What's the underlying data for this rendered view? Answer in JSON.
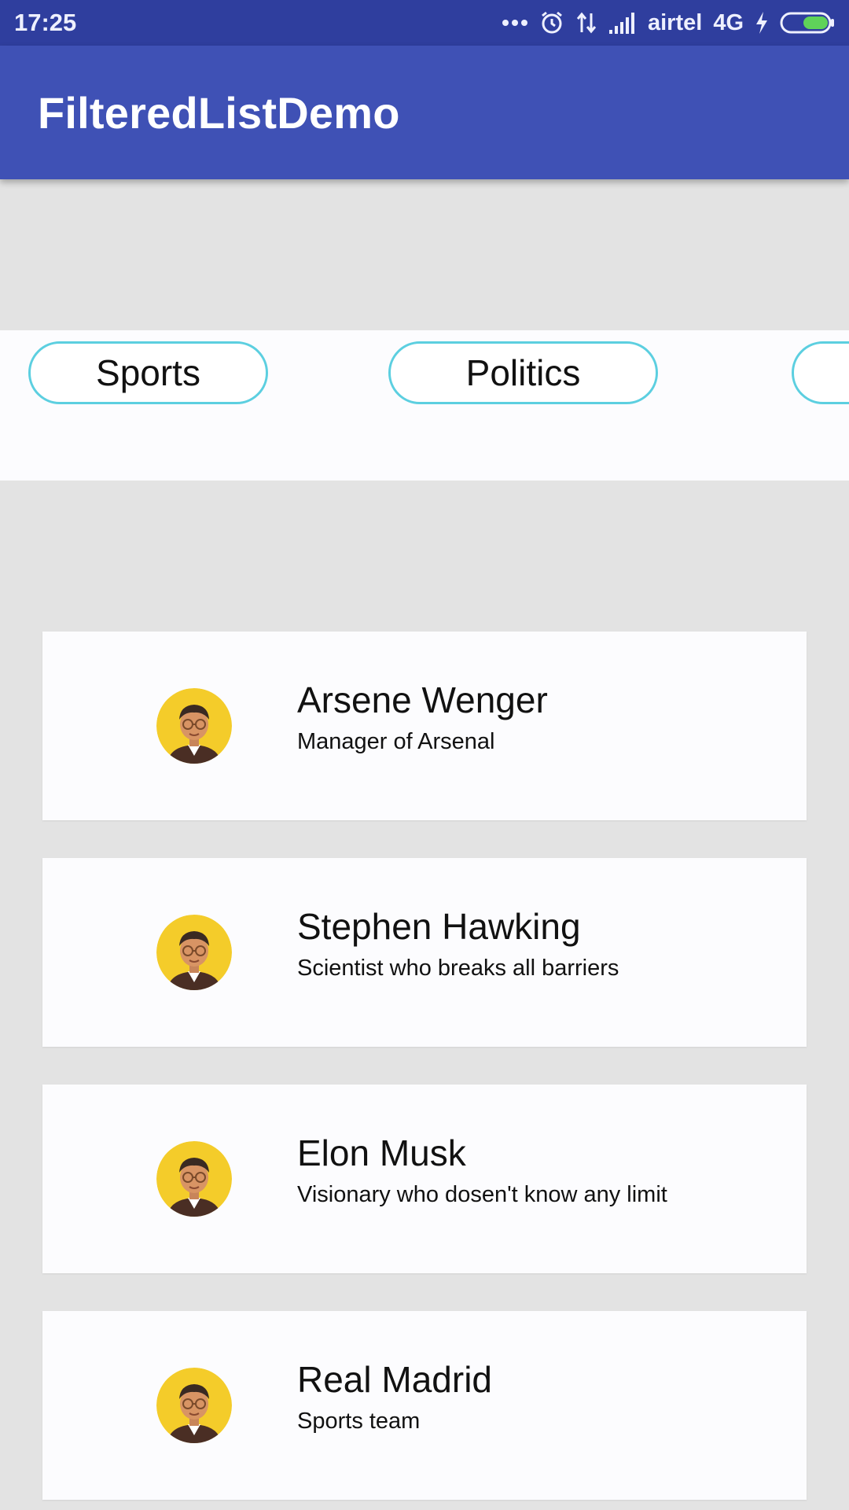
{
  "status_bar": {
    "time": "17:25",
    "carrier": "airtel",
    "network": "4G",
    "icons": [
      "more-dots-icon",
      "alarm-clock-icon",
      "data-arrows-icon",
      "signal-bars-icon",
      "charging-bolt-icon",
      "battery-icon"
    ]
  },
  "app_bar": {
    "title": "FilteredListDemo",
    "color": "#3f51b5"
  },
  "filters": {
    "chips": [
      {
        "label": "Sports"
      },
      {
        "label": "Politics"
      },
      {
        "label": ""
      }
    ],
    "accent": "#5ccfe0"
  },
  "list": {
    "items": [
      {
        "title": "Arsene Wenger",
        "subtitle": "Manager of Arsenal"
      },
      {
        "title": "Stephen Hawking",
        "subtitle": "Scientist who breaks all barriers"
      },
      {
        "title": "Elon Musk",
        "subtitle": "Visionary who dosen't know any limit"
      },
      {
        "title": "Real Madrid",
        "subtitle": "Sports team"
      }
    ]
  }
}
